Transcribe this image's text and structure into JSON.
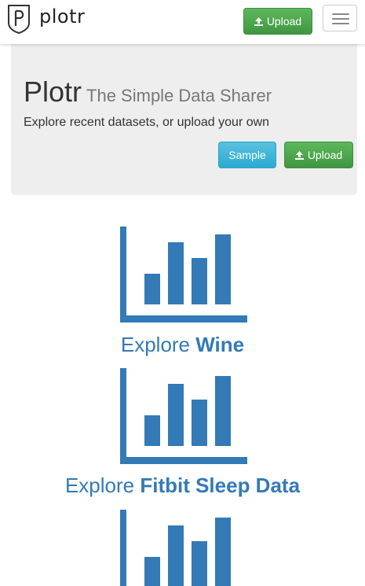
{
  "navbar": {
    "brand_text": "plotr",
    "upload_label": "Upload",
    "logo_icon": "plotr-shield-logo",
    "menu_icon": "hamburger-menu-icon"
  },
  "jumbotron": {
    "title": "Plotr",
    "subtitle": "The Simple Data Sharer",
    "lead": "Explore recent datasets, or upload your own",
    "sample_label": "Sample",
    "upload_label": "Upload"
  },
  "datasets": [
    {
      "prefix": "Explore",
      "name": "Wine",
      "icon": "bar-chart-icon"
    },
    {
      "prefix": "Explore",
      "name": "Fitbit Sleep Data",
      "icon": "bar-chart-icon"
    },
    {
      "prefix": "",
      "name": "",
      "icon": "bar-chart-icon"
    }
  ],
  "colors": {
    "link": "#337ab7",
    "success": "#5cb85c",
    "info": "#5bc0de",
    "jumbotron_bg": "#eeeeee"
  }
}
